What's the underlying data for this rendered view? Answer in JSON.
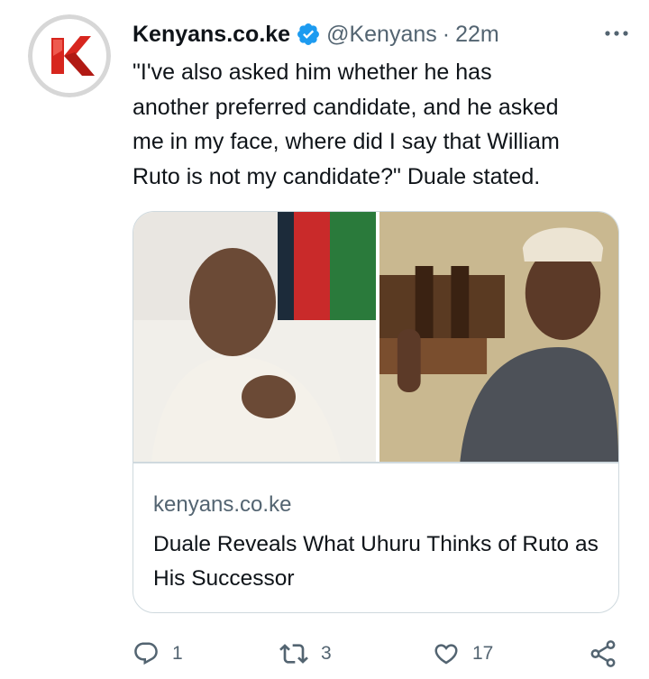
{
  "tweet": {
    "author": {
      "display_name": "Kenyans.co.ke",
      "handle": "@Kenyans",
      "separator": "·",
      "time": "22m",
      "verified": true,
      "avatar_icon": "kenyans-logo-icon"
    },
    "text": "\"I've also asked him whether he has\nanother preferred candidate, and he asked\nme in my face, where did I say that William\nRuto is not my candidate?\" Duale stated.",
    "card": {
      "domain": "kenyans.co.ke",
      "title": "Duale Reveals What Uhuru Thinks of Ruto as His Successor"
    },
    "actions": {
      "reply_count": "1",
      "retweet_count": "3",
      "like_count": "17"
    }
  },
  "colors": {
    "verified_blue": "#1d9bf0",
    "secondary_text": "#536471",
    "border": "#cfd9de",
    "brand_red": "#d7261e"
  }
}
